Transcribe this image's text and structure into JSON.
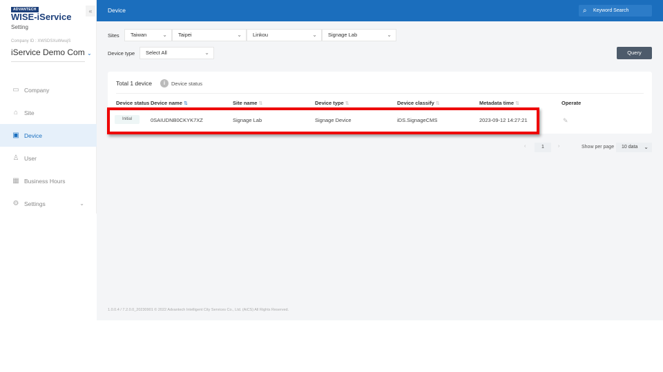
{
  "sidebar": {
    "brand_small": "ADVANTECH",
    "brand": "WISE-iService",
    "subtitle": "Setting",
    "company_id": "Company ID : XWSDSXuWwujS",
    "company_name": "iService Demo Com",
    "items": [
      {
        "label": "Company",
        "icon": "company-icon"
      },
      {
        "label": "Site",
        "icon": "site-icon"
      },
      {
        "label": "Device",
        "icon": "monitor-icon",
        "active": true
      },
      {
        "label": "User",
        "icon": "user-icon"
      },
      {
        "label": "Business Hours",
        "icon": "calendar-icon"
      },
      {
        "label": "Settings",
        "icon": "gear-icon"
      }
    ]
  },
  "header": {
    "title": "Device",
    "search_placeholder": "Keyword Search"
  },
  "filters": {
    "sites_label": "Sites",
    "sites": [
      "Taiwan",
      "Taipei",
      "Linkou",
      "Signage Lab"
    ],
    "device_type_label": "Device type",
    "device_type": "Select All",
    "query": "Query"
  },
  "table": {
    "total": "Total 1 device",
    "status_legend": "Device status",
    "columns": [
      "Device status",
      "Device name",
      "Site name",
      "Device type",
      "Device classify",
      "Metadata time",
      "Operate"
    ],
    "rows": [
      {
        "status": "Initial",
        "name": "0SAIUDNB0CKYK7XZ",
        "site": "Signage Lab",
        "type": "Signage Device",
        "classify": "iDS.SignageCMS",
        "time": "2023-09-12 14:27:21"
      }
    ]
  },
  "pagination": {
    "prev": "‹",
    "page": "1",
    "next": "›",
    "per_page_label": "Show per page",
    "per_page": "10 data"
  },
  "footer": "1.0.0.4 / 7.2.0.0_20230901 © 2022 Advantech Intelligent City Services Co., Ltd. (AiCS) All Rights Reserved.",
  "colors": {
    "header": "#1b6ebd",
    "accent": "#1a6fbf",
    "highlight": "#ee0000"
  }
}
